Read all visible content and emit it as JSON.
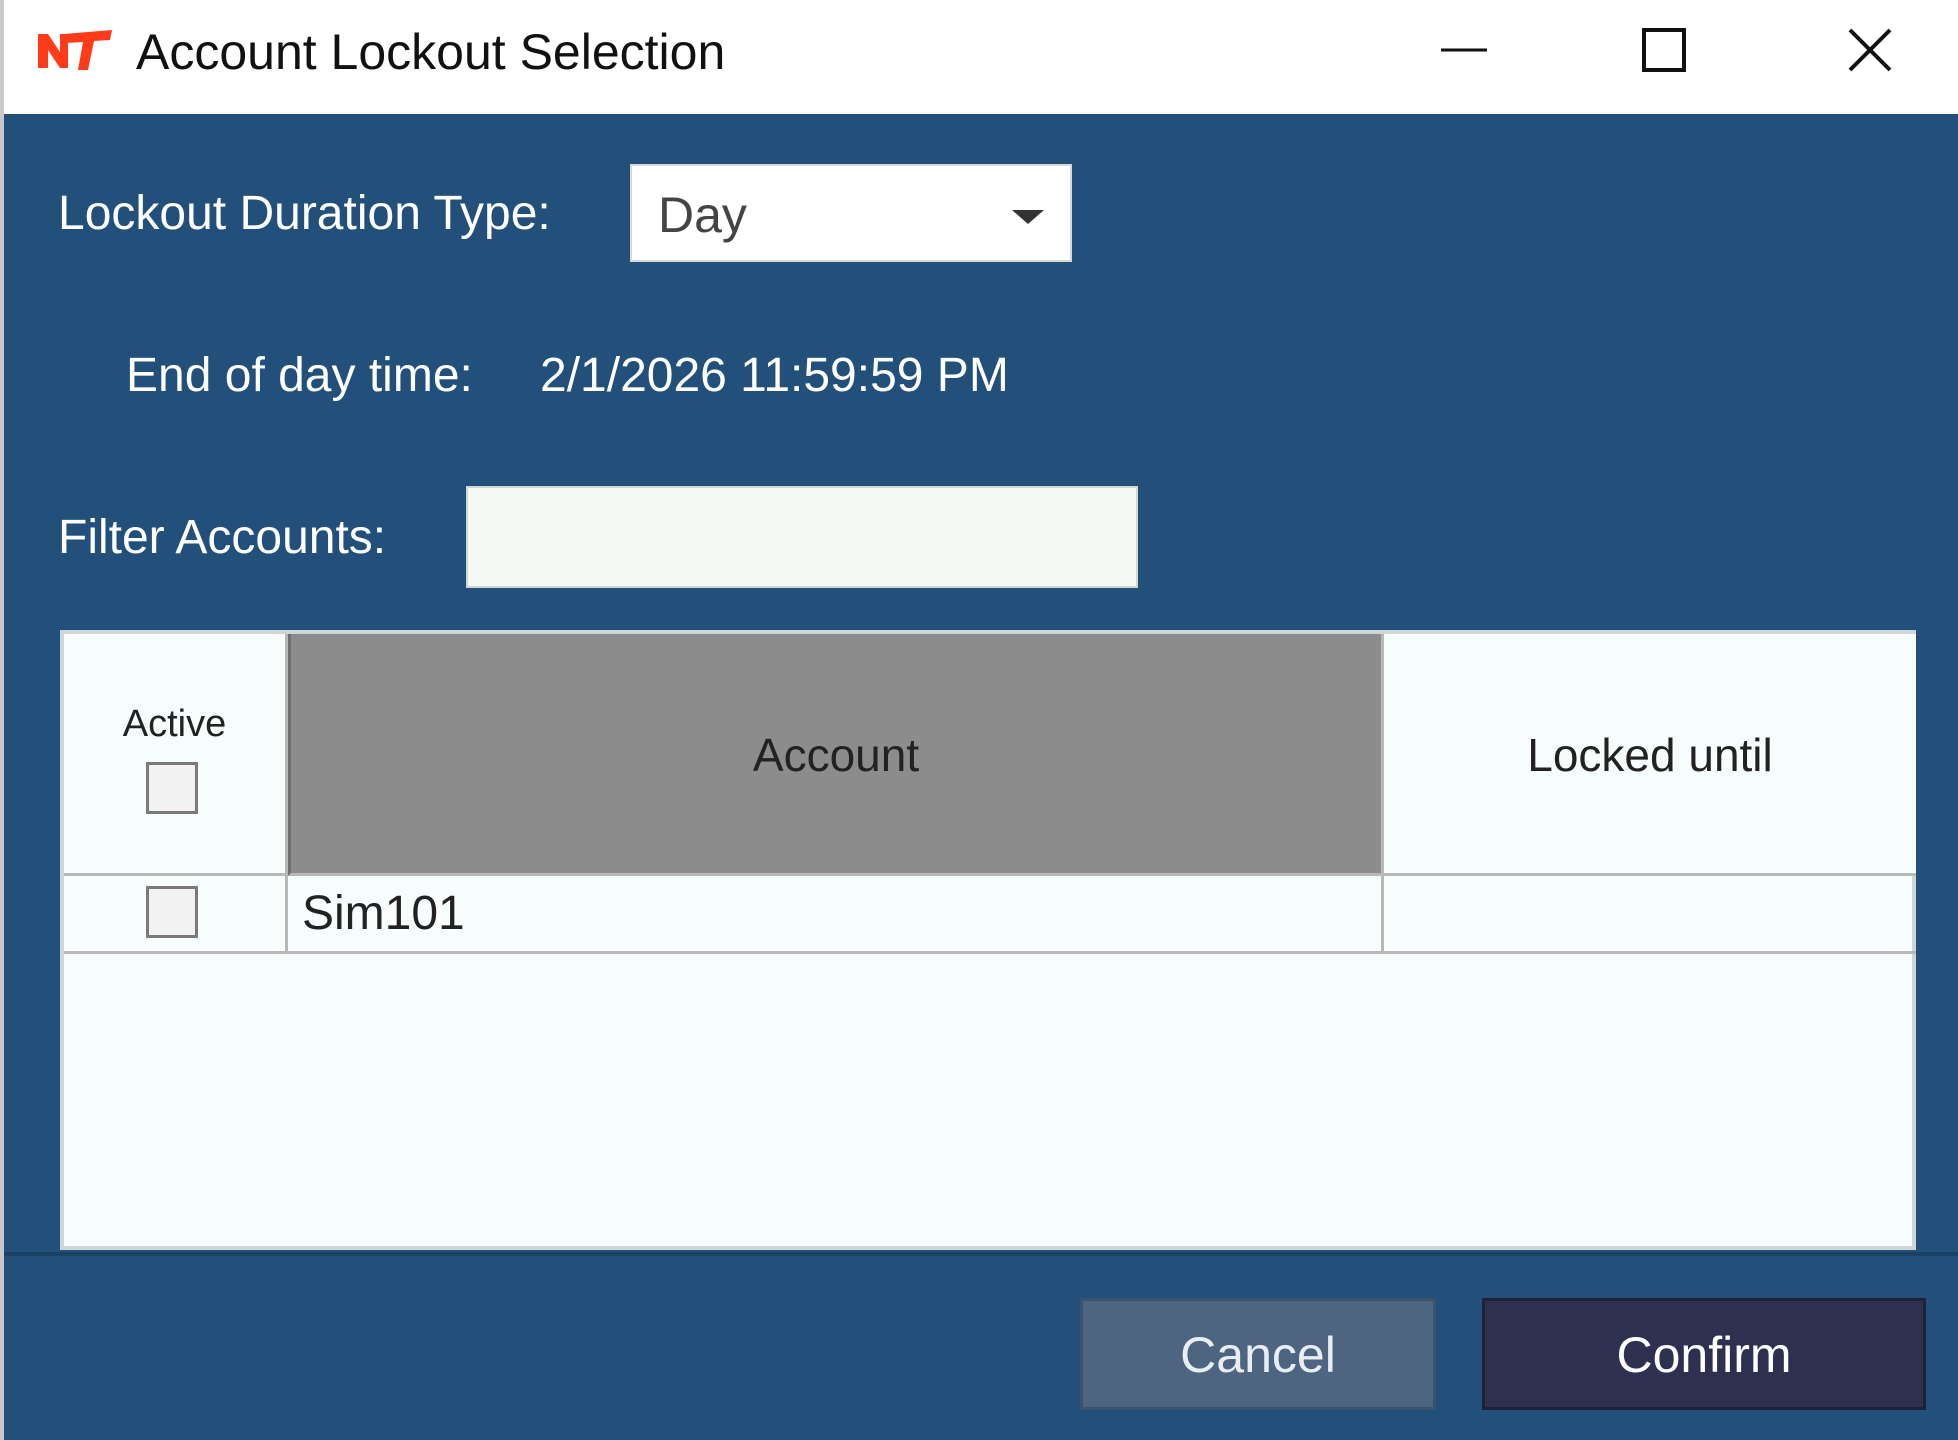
{
  "window": {
    "title": "Account Lockout Selection",
    "logo_icon": "nt-logo-icon",
    "controls": [
      "minimize-icon",
      "maximize-icon",
      "close-icon"
    ]
  },
  "form": {
    "duration_label": "Lockout Duration Type:",
    "duration_value": "Day",
    "eod_label": "End of day time:",
    "eod_value": "2/1/2026 11:59:59 PM",
    "filter_label": "Filter Accounts:",
    "filter_value": "",
    "filter_placeholder": ""
  },
  "grid": {
    "columns": [
      "Active",
      "Account",
      "Locked until"
    ],
    "header_active_checked": false,
    "rows": [
      {
        "active": false,
        "account": "Sim101",
        "locked_until": ""
      }
    ]
  },
  "buttons": {
    "cancel": "Cancel",
    "confirm": "Confirm"
  },
  "colors": {
    "background": "#22507a",
    "logo": "#ff3b1a",
    "sorted_header": "#8c8c8c",
    "confirm_button": "#2e3050",
    "cancel_button": "#4d6580"
  }
}
